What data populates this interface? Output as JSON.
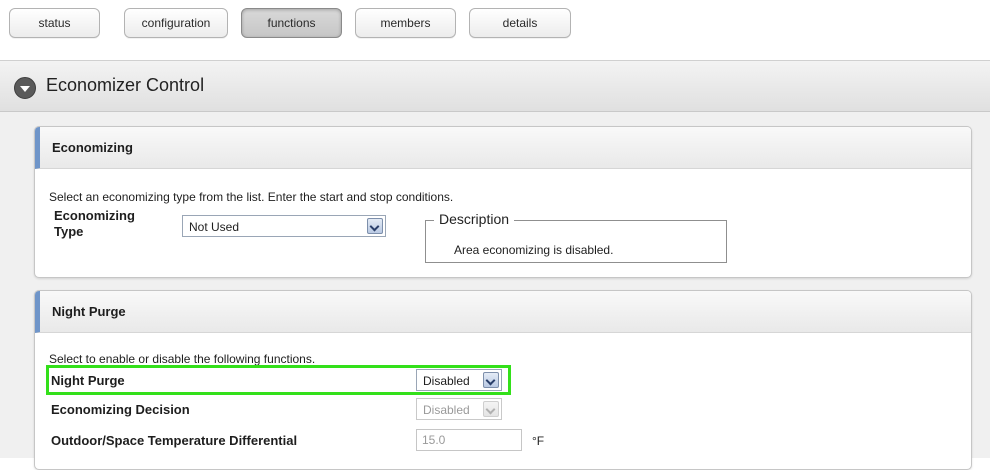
{
  "tabs": [
    {
      "label": "status"
    },
    {
      "label": "configuration"
    },
    {
      "label": "functions"
    },
    {
      "label": "members"
    },
    {
      "label": "details"
    }
  ],
  "active_tab": "functions",
  "section": {
    "title": "Economizer Control"
  },
  "economizing": {
    "heading": "Economizing",
    "instruction": "Select an economizing type from the list. Enter the start and stop conditions.",
    "type_label": "Economizing Type",
    "type_value": "Not Used",
    "description_legend": "Description",
    "description_text": "Area economizing is disabled."
  },
  "night_purge": {
    "heading": "Night Purge",
    "instruction": "Select to enable or disable the following functions.",
    "rows": [
      {
        "label": "Night Purge",
        "value": "Disabled"
      },
      {
        "label": "Economizing Decision",
        "value": "Disabled"
      },
      {
        "label": "Outdoor/Space Temperature Differential",
        "value": "15.0",
        "unit": "°F"
      }
    ]
  },
  "colors": {
    "highlight": "#33e01a",
    "panel_accent": "#6f95c9"
  }
}
